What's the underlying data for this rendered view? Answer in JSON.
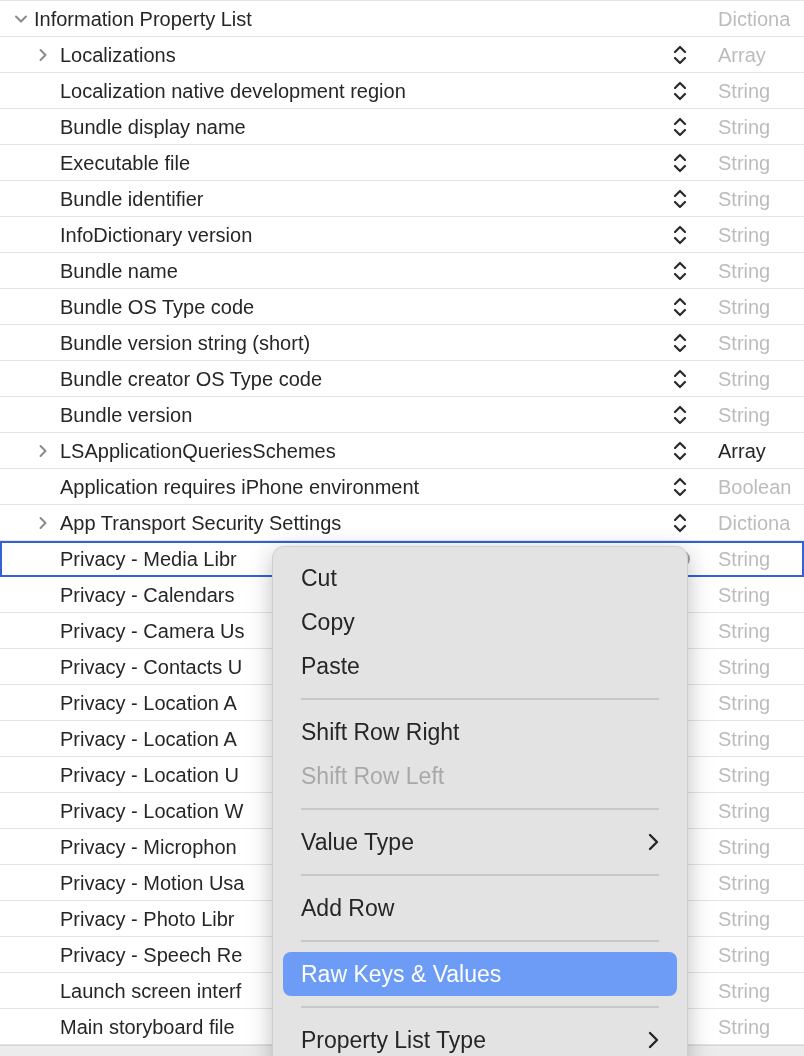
{
  "root": {
    "key": "Information Property List",
    "type": "Dictiona",
    "dimmed": true,
    "selected": false,
    "kind": "collapsible",
    "expanded": true,
    "children": [
      {
        "key": "Localizations",
        "type": "Array",
        "dimmed": true,
        "selected": false,
        "kind": "collapsible",
        "expanded": false
      },
      {
        "key": "Localization native development region",
        "type": "String",
        "dimmed": true,
        "selected": false,
        "kind": "leaf"
      },
      {
        "key": "Bundle display name",
        "type": "String",
        "dimmed": true,
        "selected": false,
        "kind": "leaf"
      },
      {
        "key": "Executable file",
        "type": "String",
        "dimmed": true,
        "selected": false,
        "kind": "leaf"
      },
      {
        "key": "Bundle identifier",
        "type": "String",
        "dimmed": true,
        "selected": false,
        "kind": "leaf"
      },
      {
        "key": "InfoDictionary version",
        "type": "String",
        "dimmed": true,
        "selected": false,
        "kind": "leaf"
      },
      {
        "key": "Bundle name",
        "type": "String",
        "dimmed": true,
        "selected": false,
        "kind": "leaf"
      },
      {
        "key": "Bundle OS Type code",
        "type": "String",
        "dimmed": true,
        "selected": false,
        "kind": "leaf"
      },
      {
        "key": "Bundle version string (short)",
        "type": "String",
        "dimmed": true,
        "selected": false,
        "kind": "leaf"
      },
      {
        "key": "Bundle creator OS Type code",
        "type": "String",
        "dimmed": true,
        "selected": false,
        "kind": "leaf"
      },
      {
        "key": "Bundle version",
        "type": "String",
        "dimmed": true,
        "selected": false,
        "kind": "leaf"
      },
      {
        "key": "LSApplicationQueriesSchemes",
        "type": "Array",
        "dimmed": false,
        "selected": false,
        "kind": "collapsible",
        "expanded": false
      },
      {
        "key": "Application requires iPhone environment",
        "type": "Boolean",
        "dimmed": true,
        "selected": false,
        "kind": "leaf"
      },
      {
        "key": "App Transport Security Settings",
        "type": "Dictiona",
        "dimmed": true,
        "selected": false,
        "kind": "collapsible",
        "expanded": false
      },
      {
        "key": "Privacy - Media Libr",
        "type": "String",
        "dimmed": true,
        "selected": true,
        "kind": "leaf"
      },
      {
        "key": "Privacy - Calendars",
        "type": "String",
        "dimmed": true,
        "selected": false,
        "kind": "leaf"
      },
      {
        "key": "Privacy - Camera Us",
        "type": "String",
        "dimmed": true,
        "selected": false,
        "kind": "leaf"
      },
      {
        "key": "Privacy - Contacts U",
        "type": "String",
        "dimmed": true,
        "selected": false,
        "kind": "leaf"
      },
      {
        "key": "Privacy - Location A",
        "type": "String",
        "dimmed": true,
        "selected": false,
        "kind": "leaf"
      },
      {
        "key": "Privacy - Location A",
        "type": "String",
        "dimmed": true,
        "selected": false,
        "kind": "leaf"
      },
      {
        "key": "Privacy - Location U",
        "type": "String",
        "dimmed": true,
        "selected": false,
        "kind": "leaf"
      },
      {
        "key": "Privacy - Location W",
        "type": "String",
        "dimmed": true,
        "selected": false,
        "kind": "leaf"
      },
      {
        "key": "Privacy - Microphon",
        "type": "String",
        "dimmed": true,
        "selected": false,
        "kind": "leaf"
      },
      {
        "key": "Privacy - Motion Usa",
        "type": "String",
        "dimmed": true,
        "selected": false,
        "kind": "leaf"
      },
      {
        "key": "Privacy - Photo Libr",
        "type": "String",
        "dimmed": true,
        "selected": false,
        "kind": "leaf"
      },
      {
        "key": "Privacy - Speech Re",
        "type": "String",
        "dimmed": true,
        "selected": false,
        "kind": "leaf"
      },
      {
        "key": "Launch screen interf",
        "type": "String",
        "dimmed": true,
        "selected": false,
        "kind": "leaf"
      },
      {
        "key": "Main storyboard file",
        "type": "String",
        "dimmed": true,
        "selected": false,
        "kind": "leaf"
      }
    ]
  },
  "context_menu": {
    "items": [
      {
        "kind": "item",
        "label": "Cut",
        "disabled": false,
        "selected": false,
        "submenu": false
      },
      {
        "kind": "item",
        "label": "Copy",
        "disabled": false,
        "selected": false,
        "submenu": false
      },
      {
        "kind": "item",
        "label": "Paste",
        "disabled": false,
        "selected": false,
        "submenu": false
      },
      {
        "kind": "separator"
      },
      {
        "kind": "item",
        "label": "Shift Row Right",
        "disabled": false,
        "selected": false,
        "submenu": false
      },
      {
        "kind": "item",
        "label": "Shift Row Left",
        "disabled": true,
        "selected": false,
        "submenu": false
      },
      {
        "kind": "separator"
      },
      {
        "kind": "item",
        "label": "Value Type",
        "disabled": false,
        "selected": false,
        "submenu": true
      },
      {
        "kind": "separator"
      },
      {
        "kind": "item",
        "label": "Add Row",
        "disabled": false,
        "selected": false,
        "submenu": false
      },
      {
        "kind": "separator"
      },
      {
        "kind": "item",
        "label": "Raw Keys & Values",
        "disabled": false,
        "selected": true,
        "submenu": false
      },
      {
        "kind": "separator"
      },
      {
        "kind": "item",
        "label": "Property List Type",
        "disabled": false,
        "selected": false,
        "submenu": true
      }
    ]
  }
}
